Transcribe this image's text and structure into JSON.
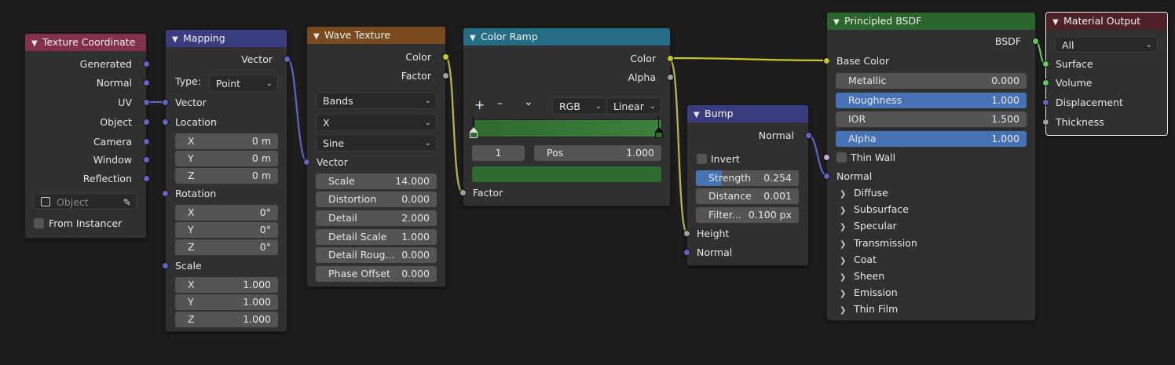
{
  "colors": {
    "background": "#1d1d1d",
    "node_body": "#303030",
    "input_header": "#83314a",
    "vector_header": "#3b3c80",
    "texture_header": "#7a4a1f",
    "converter_header": "#236e85",
    "shader_header": "#2b652b",
    "output_header": "#4e2128",
    "vector_socket": "#6363c7",
    "color_socket": "#c7c729",
    "float_socket": "#a1a1a1",
    "shader_socket": "#63c763",
    "highlight": "#4772b3"
  },
  "texcoord": {
    "title": "Texture Coordinate",
    "outputs": [
      "Generated",
      "Normal",
      "UV",
      "Object",
      "Camera",
      "Window",
      "Reflection"
    ],
    "object_placeholder": "Object",
    "from_instancer": "From Instancer"
  },
  "mapping": {
    "title": "Mapping",
    "out_vector": "Vector",
    "type_label": "Type:",
    "type_value": "Point",
    "in_vector": "Vector",
    "location": "Location",
    "rotation": "Rotation",
    "scale": "Scale",
    "loc": [
      {
        "axis": "X",
        "value": "0 m"
      },
      {
        "axis": "Y",
        "value": "0 m"
      },
      {
        "axis": "Z",
        "value": "0 m"
      }
    ],
    "rot": [
      {
        "axis": "X",
        "value": "0°"
      },
      {
        "axis": "Y",
        "value": "0°"
      },
      {
        "axis": "Z",
        "value": "0°"
      }
    ],
    "scl": [
      {
        "axis": "X",
        "value": "1.000"
      },
      {
        "axis": "Y",
        "value": "1.000"
      },
      {
        "axis": "Z",
        "value": "1.000"
      }
    ]
  },
  "wave": {
    "title": "Wave Texture",
    "out_color": "Color",
    "out_factor": "Factor",
    "wave_type": "Bands",
    "direction": "X",
    "profile": "Sine",
    "in_vector": "Vector",
    "params": [
      {
        "label": "Scale",
        "value": "14.000"
      },
      {
        "label": "Distortion",
        "value": "0.000"
      },
      {
        "label": "Detail",
        "value": "2.000"
      },
      {
        "label": "Detail Scale",
        "value": "1.000"
      },
      {
        "label": "Detail Roug...",
        "value": "0.000"
      },
      {
        "label": "Phase Offset",
        "value": "0.000"
      }
    ]
  },
  "ramp": {
    "title": "Color Ramp",
    "out_color": "Color",
    "out_alpha": "Alpha",
    "add": "+",
    "remove": "–",
    "menu": "⌄",
    "color_mode": "RGB",
    "interpolation": "Linear",
    "index": "1",
    "pos_label": "Pos",
    "pos_value": "1.000",
    "in_factor": "Factor",
    "stop_color": "#2f6a2f"
  },
  "bump": {
    "title": "Bump",
    "out_normal": "Normal",
    "invert": "Invert",
    "strength_label": "Strength",
    "strength_value": "0.254",
    "strength_fraction": 0.254,
    "distance_label": "Distance",
    "distance_value": "0.001",
    "filter_label": "Filter...",
    "filter_value": "0.100 px",
    "in_height": "Height",
    "in_normal": "Normal"
  },
  "bsdf": {
    "title": "Principled BSDF",
    "out_bsdf": "BSDF",
    "base_color": "Base Color",
    "fields": [
      {
        "label": "Metallic",
        "value": "0.000"
      },
      {
        "label": "Roughness",
        "value": "1.000"
      },
      {
        "label": "IOR",
        "value": "1.500"
      },
      {
        "label": "Alpha",
        "value": "1.000"
      }
    ],
    "thin_wall": "Thin Wall",
    "normal": "Normal",
    "panels": [
      "Diffuse",
      "Subsurface",
      "Specular",
      "Transmission",
      "Coat",
      "Sheen",
      "Emission",
      "Thin Film"
    ]
  },
  "output": {
    "title": "Material Output",
    "target": "All",
    "inputs": [
      "Surface",
      "Volume",
      "Displacement",
      "Thickness"
    ]
  }
}
